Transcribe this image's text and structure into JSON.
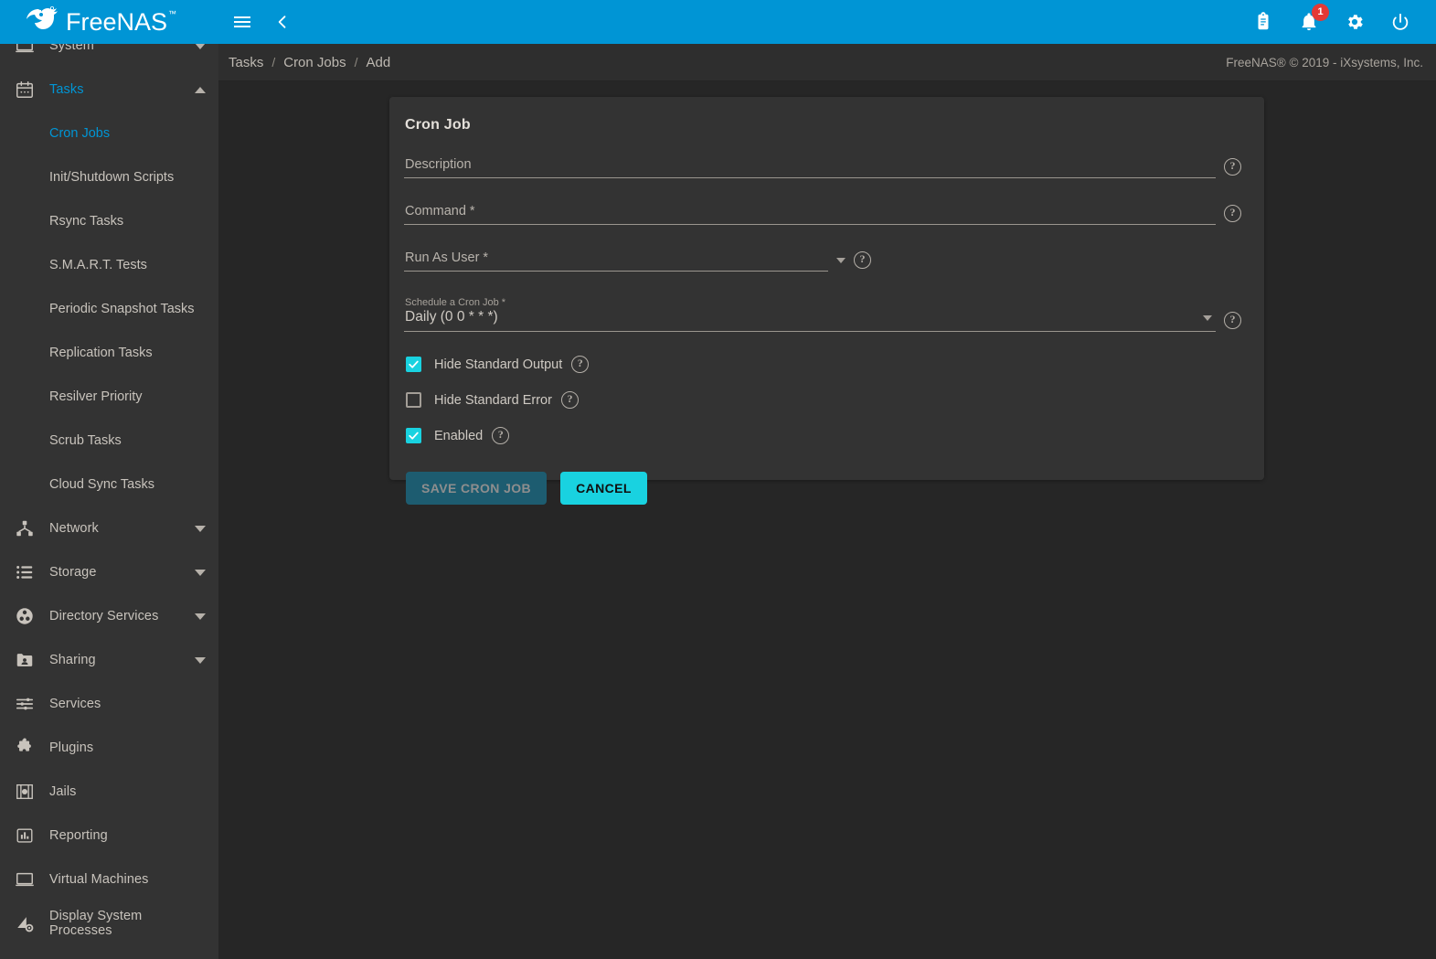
{
  "app": {
    "brand": "FreeNAS",
    "copyright": "FreeNAS® © 2019 - iXsystems, Inc."
  },
  "topbar": {
    "menu_icon": "hamburger-menu-icon",
    "collapse_icon": "chevron-left-icon",
    "right_icons": [
      {
        "name": "clipboard-icon",
        "label": "Tasks"
      },
      {
        "name": "notifications-bell-icon",
        "label": "Alerts",
        "badge": "1"
      },
      {
        "name": "gear-icon",
        "label": "Settings"
      },
      {
        "name": "power-icon",
        "label": "Power"
      }
    ]
  },
  "breadcrumb": {
    "items": [
      "Tasks",
      "Cron Jobs",
      "Add"
    ],
    "separator": "/"
  },
  "sidebar": {
    "items": [
      {
        "label": "System",
        "icon": "desktop-icon",
        "expandable": true,
        "expanded": false,
        "active": false
      },
      {
        "label": "Tasks",
        "icon": "calendar-icon",
        "expandable": true,
        "expanded": true,
        "active": true
      },
      {
        "label": "Network",
        "icon": "network-hub-icon",
        "expandable": true,
        "expanded": false,
        "active": false
      },
      {
        "label": "Storage",
        "icon": "storage-list-icon",
        "expandable": true,
        "expanded": false,
        "active": false
      },
      {
        "label": "Directory Services",
        "icon": "directory-services-icon",
        "expandable": true,
        "expanded": false,
        "active": false
      },
      {
        "label": "Sharing",
        "icon": "folder-shared-icon",
        "expandable": true,
        "expanded": false,
        "active": false
      },
      {
        "label": "Services",
        "icon": "tune-sliders-icon",
        "expandable": false,
        "expanded": false,
        "active": false
      },
      {
        "label": "Plugins",
        "icon": "puzzle-piece-icon",
        "expandable": false,
        "expanded": false,
        "active": false
      },
      {
        "label": "Jails",
        "icon": "jail-bars-icon",
        "expandable": false,
        "expanded": false,
        "active": false
      },
      {
        "label": "Reporting",
        "icon": "bar-chart-icon",
        "expandable": false,
        "expanded": false,
        "active": false
      },
      {
        "label": "Virtual Machines",
        "icon": "monitor-icon",
        "expandable": false,
        "expanded": false,
        "active": false
      },
      {
        "label": "Display System Processes",
        "icon": "processes-icon",
        "expandable": false,
        "expanded": false,
        "active": false
      }
    ],
    "tasks_subitems": [
      {
        "label": "Cron Jobs",
        "active": true
      },
      {
        "label": "Init/Shutdown Scripts",
        "active": false
      },
      {
        "label": "Rsync Tasks",
        "active": false
      },
      {
        "label": "S.M.A.R.T. Tests",
        "active": false
      },
      {
        "label": "Periodic Snapshot Tasks",
        "active": false
      },
      {
        "label": "Replication Tasks",
        "active": false
      },
      {
        "label": "Resilver Priority",
        "active": false
      },
      {
        "label": "Scrub Tasks",
        "active": false
      },
      {
        "label": "Cloud Sync Tasks",
        "active": false
      }
    ]
  },
  "form": {
    "title": "Cron Job",
    "description": {
      "label": "Description",
      "value": "",
      "help": "?"
    },
    "command": {
      "label": "Command *",
      "value": "",
      "help": "?"
    },
    "run_as_user": {
      "label": "Run As User *",
      "value": "",
      "help": "?"
    },
    "schedule": {
      "label": "Schedule a Cron Job *",
      "value": "Daily (0 0 * * *)",
      "help": "?"
    },
    "checkboxes": [
      {
        "label": "Hide Standard Output",
        "checked": true,
        "help": "?"
      },
      {
        "label": "Hide Standard Error",
        "checked": false,
        "help": "?"
      },
      {
        "label": "Enabled",
        "checked": true,
        "help": "?"
      }
    ],
    "buttons": {
      "save": {
        "label": "SAVE CRON JOB",
        "disabled": true
      },
      "cancel": {
        "label": "CANCEL",
        "disabled": false
      }
    }
  },
  "colors": {
    "brand_blue": "#0095d5",
    "accent_cyan": "#19d2e0",
    "badge_red": "#e53935",
    "sidebar_bg": "#333333",
    "content_bg": "#262626"
  }
}
